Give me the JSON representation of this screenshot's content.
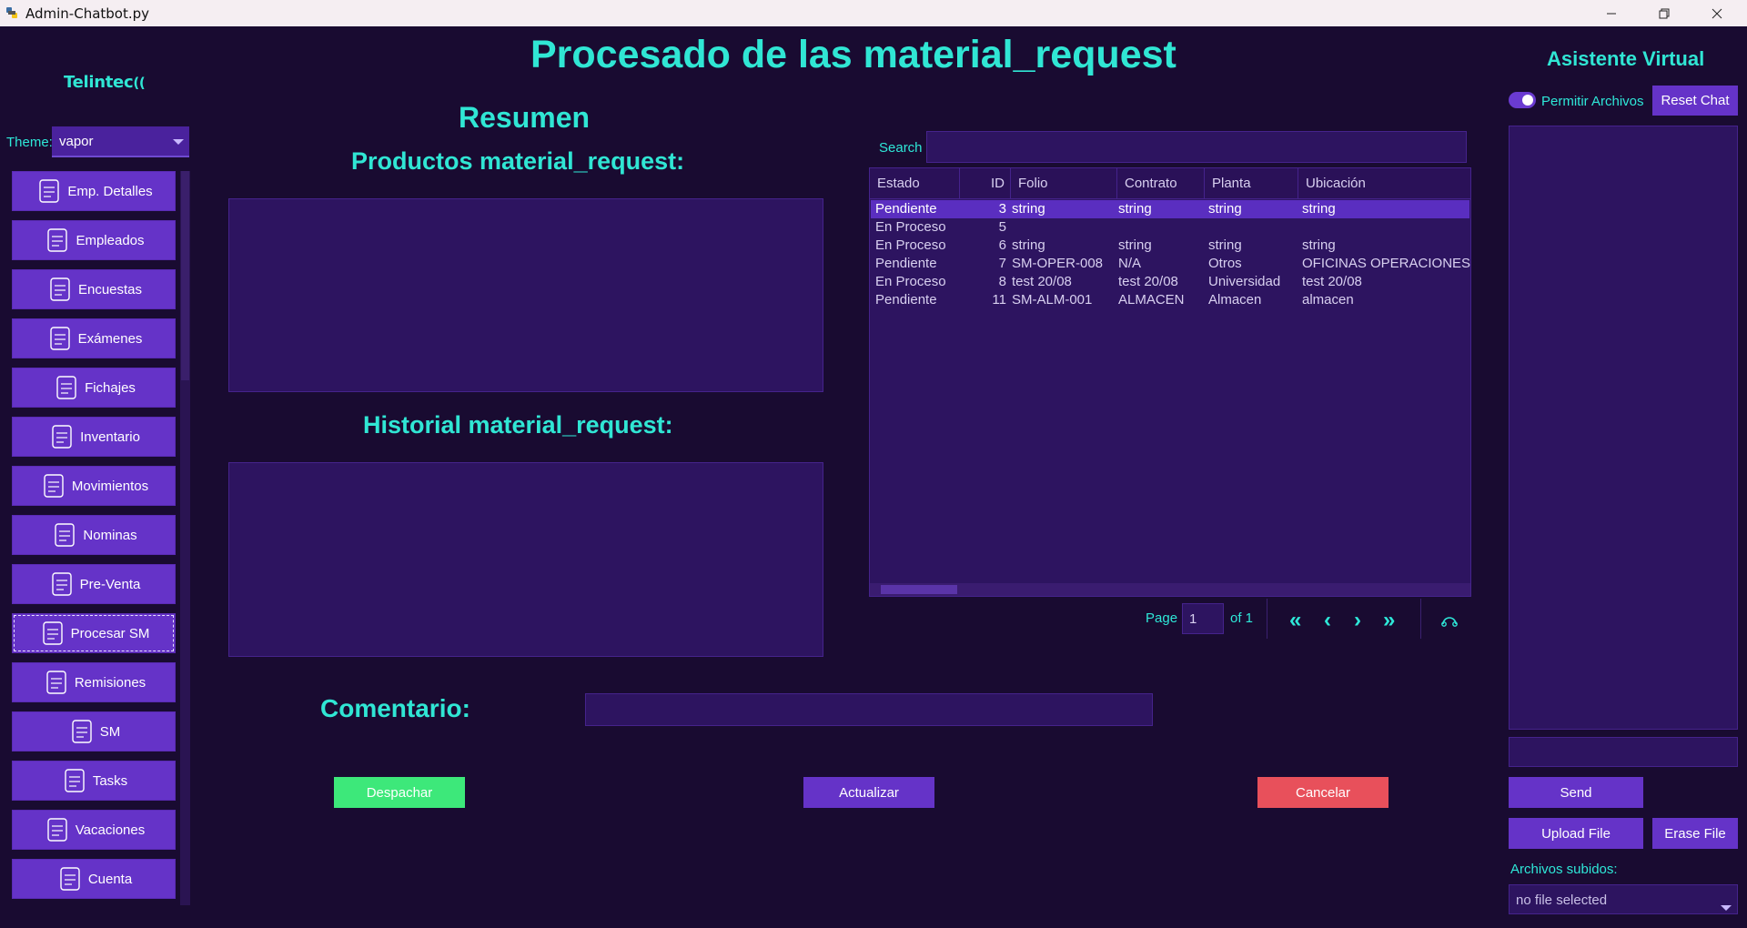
{
  "window": {
    "title": "Admin-Chatbot.py",
    "controls": [
      "minimize-icon",
      "restore-icon",
      "close-icon"
    ]
  },
  "sidebar": {
    "logo_text": "Telintec",
    "theme_label": "Theme:",
    "theme_value": "vapor",
    "items": [
      {
        "label": "Emp. Detalles",
        "icon": "employee-details-icon"
      },
      {
        "label": "Empleados",
        "icon": "employees-icon"
      },
      {
        "label": "Encuestas",
        "icon": "survey-icon"
      },
      {
        "label": "Exámenes",
        "icon": "exam-icon"
      },
      {
        "label": "Fichajes",
        "icon": "checkin-icon"
      },
      {
        "label": "Inventario",
        "icon": "inventory-icon"
      },
      {
        "label": "Movimientos",
        "icon": "movements-icon"
      },
      {
        "label": "Nominas",
        "icon": "payroll-icon"
      },
      {
        "label": "Pre-Venta",
        "icon": "presale-icon"
      },
      {
        "label": "Procesar SM",
        "icon": "process-sm-icon"
      },
      {
        "label": "Remisiones",
        "icon": "remissions-icon"
      },
      {
        "label": "SM",
        "icon": "sm-icon"
      },
      {
        "label": "Tasks",
        "icon": "tasks-icon"
      },
      {
        "label": "Vacaciones",
        "icon": "vacation-icon"
      },
      {
        "label": "Cuenta",
        "icon": "account-icon"
      }
    ],
    "active_item": "Procesar SM"
  },
  "main": {
    "title": "Procesado de las material_request",
    "summary_heading": "Resumen",
    "products_heading": "Productos material_request:",
    "history_heading": "Historial material_request:",
    "comment_label": "Comentario:",
    "buttons": {
      "dispatch": "Despachar",
      "update": "Actualizar",
      "cancel": "Cancelar"
    }
  },
  "table": {
    "search_label": "Search",
    "columns": [
      "Estado",
      "ID",
      "Folio",
      "Contrato",
      "Planta",
      "Ubicación"
    ],
    "rows": [
      [
        "Pendiente",
        "3",
        "string",
        "string",
        "string",
        "string"
      ],
      [
        "En Proceso",
        "5",
        "",
        "",
        "",
        ""
      ],
      [
        "En Proceso",
        "6",
        "string",
        "string",
        "string",
        "string"
      ],
      [
        "Pendiente",
        "7",
        "SM-OPER-008",
        "N/A",
        "Otros",
        "OFICINAS OPERACIONES"
      ],
      [
        "En Proceso",
        "8",
        "test 20/08",
        "test 20/08",
        "Universidad",
        "test 20/08"
      ],
      [
        "Pendiente",
        "11",
        "SM-ALM-001",
        "ALMACEN",
        "Almacen",
        "almacen"
      ]
    ],
    "selected_row": 0,
    "pager": {
      "page_label": "Page",
      "page_value": "1",
      "of_label": "of 1"
    }
  },
  "assistant": {
    "title": "Asistente Virtual",
    "toggle_label": "Permitir Archivos",
    "toggle_on": true,
    "reset_label": "Reset Chat",
    "send_label": "Send",
    "upload_label": "Upload File",
    "erase_label": "Erase File",
    "files_label": "Archivos subidos:",
    "file_select_value": "no file selected"
  },
  "colors": {
    "background": "#190b31",
    "accent_text": "#30e6d4",
    "button": "#6533c8",
    "dispatch": "#3de87a",
    "cancel": "#e8505b",
    "panel": "#2d1460"
  }
}
